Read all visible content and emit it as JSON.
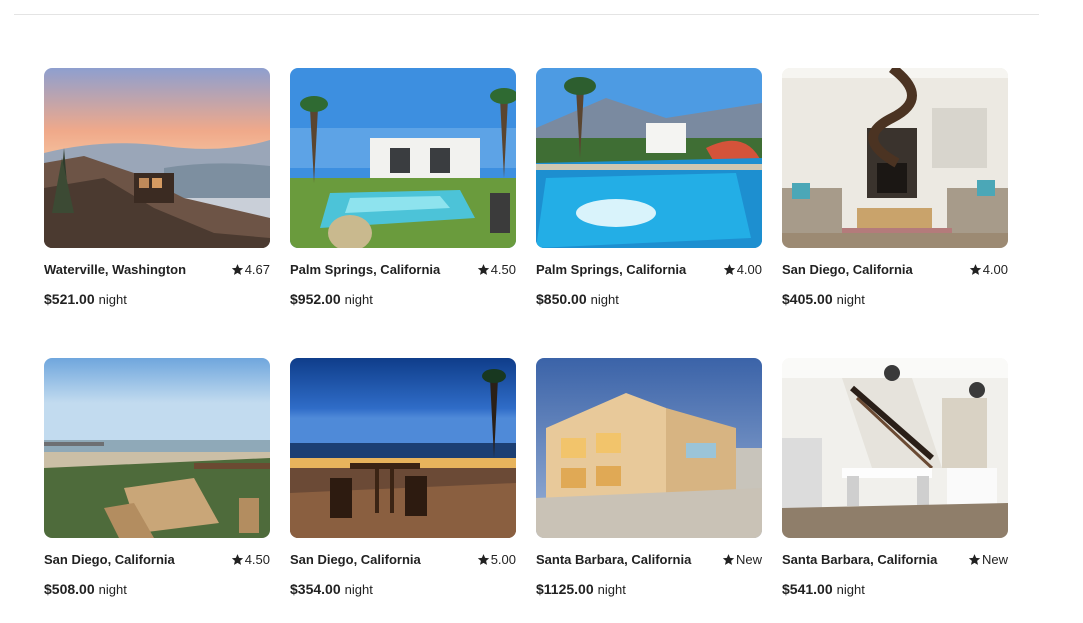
{
  "listings": [
    {
      "location": "Waterville, Washington",
      "rating": "4.67",
      "price": "$521.00",
      "unit": "night",
      "image": "tiny-cabin-on-mountain-ridge-at-sunset"
    },
    {
      "location": "Palm Springs, California",
      "rating": "4.50",
      "price": "$952.00",
      "unit": "night",
      "image": "modern-house-with-pool-and-palm-trees"
    },
    {
      "location": "Palm Springs, California",
      "rating": "4.00",
      "price": "$850.00",
      "unit": "night",
      "image": "resort-pool-with-waterslide"
    },
    {
      "location": "San Diego, California",
      "rating": "4.00",
      "price": "$405.00",
      "unit": "night",
      "image": "living-room-with-spiral-staircase"
    },
    {
      "location": "San Diego, California",
      "rating": "4.50",
      "price": "$508.00",
      "unit": "night",
      "image": "beach-patio-with-picnic-table-and-pier"
    },
    {
      "location": "San Diego, California",
      "rating": "5.00",
      "price": "$354.00",
      "unit": "night",
      "image": "rooftop-deck-at-dusk-by-ocean"
    },
    {
      "location": "Santa Barbara, California",
      "rating": "New",
      "price": "$1125.00",
      "unit": "night",
      "image": "beachfront-house-at-twilight"
    },
    {
      "location": "Santa Barbara, California",
      "rating": "New",
      "price": "$541.00",
      "unit": "night",
      "image": "dining-room-with-staircase-and-chandeliers"
    }
  ],
  "icons": {
    "rating": "star-icon"
  },
  "colors": {
    "text": "#222222",
    "divider": "#e4e4e4"
  }
}
